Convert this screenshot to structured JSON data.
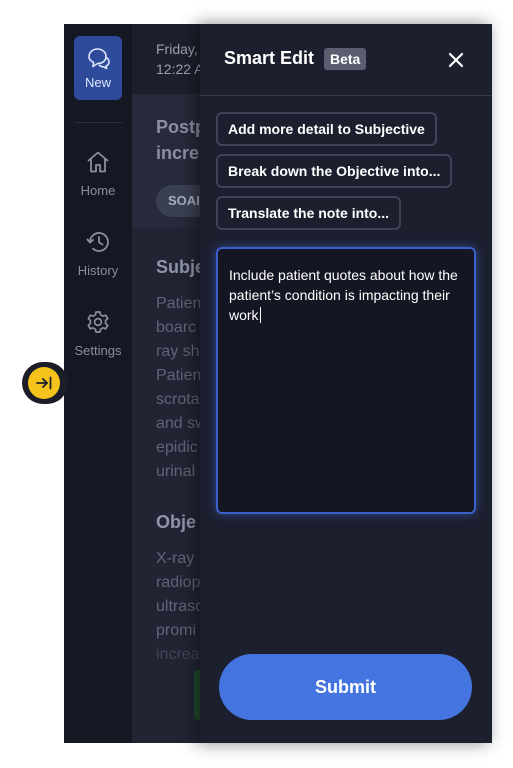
{
  "sidebar": {
    "new_label": "New",
    "items": [
      {
        "label": "Home",
        "icon": "home-icon"
      },
      {
        "label": "History",
        "icon": "history-icon"
      },
      {
        "label": "Settings",
        "icon": "gear-icon"
      }
    ]
  },
  "toggle": {
    "icon": "collapse-arrow-icon",
    "color": "#f5c31c"
  },
  "document": {
    "date": "Friday,\n12:22 A",
    "title": "Postp\nincre",
    "chip_label": "SOAI",
    "sections": [
      {
        "heading": "Subje",
        "lines": [
          "Patien",
          "boarc",
          "ray sh",
          "Patien",
          "scrota",
          "and sw",
          "epidic",
          "urinal"
        ]
      },
      {
        "heading": "Obje",
        "lines": [
          "X-ray",
          "radiop",
          "ultrasc",
          "promi",
          "increa"
        ]
      }
    ]
  },
  "panel": {
    "title": "Smart Edit",
    "badge": "Beta",
    "close_icon": "close-icon",
    "suggestions": [
      "Add more detail to Subjective",
      "Break down the Objective into...",
      "Translate the note into..."
    ],
    "input_value": "Include patient quotes about how the patient’s condition is impacting their work",
    "submit_label": "Submit"
  },
  "colors": {
    "accent": "#4474e0",
    "focus_border": "#3c5fc9",
    "panel_bg": "#1c1f2e",
    "rail_bg": "#151722"
  }
}
